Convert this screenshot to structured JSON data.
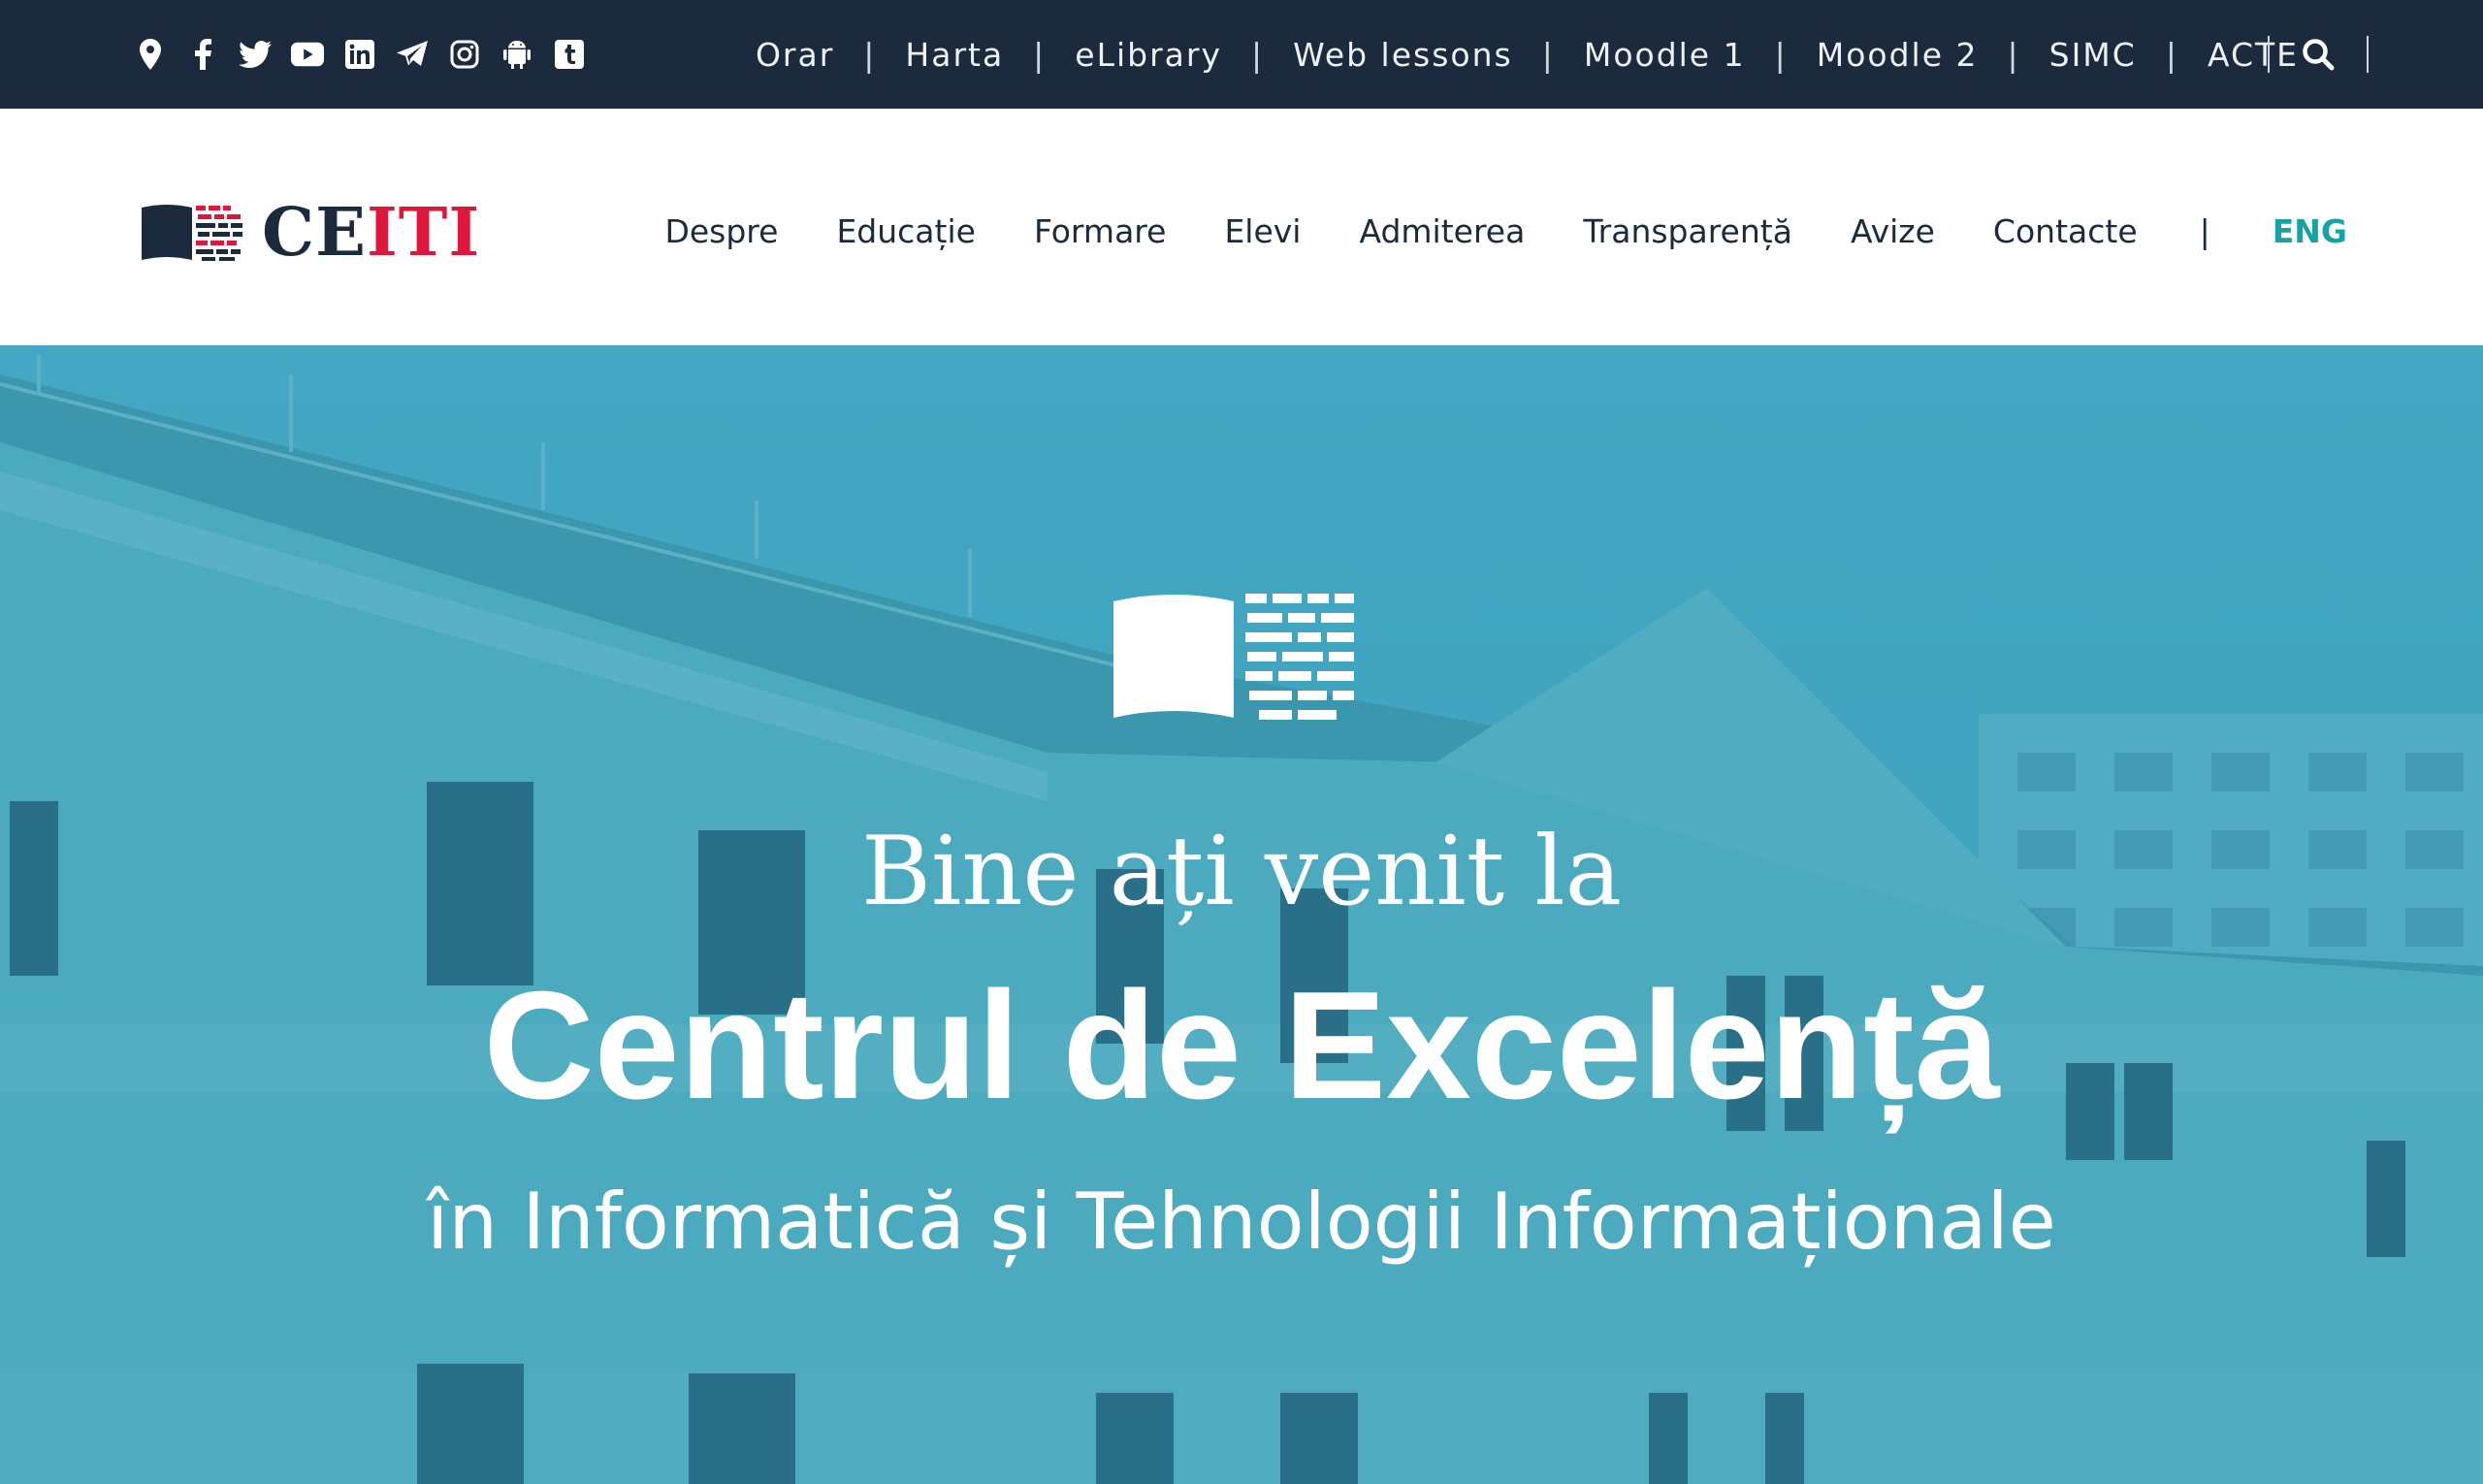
{
  "topbar": {
    "social_icons": [
      "map-pin-icon",
      "facebook-icon",
      "twitter-icon",
      "youtube-icon",
      "linkedin-icon",
      "telegram-icon",
      "instagram-icon",
      "android-icon",
      "tumblr-icon"
    ],
    "links": [
      "Orar",
      "Harta",
      "eLibrary",
      "Web lessons",
      "Moodle 1",
      "Moodle 2",
      "SIMC",
      "ACTE"
    ],
    "separator": "|",
    "search_icon": "search-icon"
  },
  "header": {
    "logo_ce": "CE",
    "logo_iti": "ITI",
    "nav": [
      "Despre",
      "Educație",
      "Formare",
      "Elevi",
      "Admiterea",
      "Transparență",
      "Avize",
      "Contacte"
    ],
    "nav_separator": "|",
    "language": "ENG"
  },
  "hero": {
    "line1": "Bine ați venit la",
    "line2": "Centrul de Excelență",
    "line3": "în Informatică și Tehnologii Informaționale"
  },
  "colors": {
    "topbar_bg": "#1c2a3d",
    "brand_red": "#e0173d",
    "brand_navy": "#1c2a3d",
    "accent_teal": "#17a3a3",
    "hero_overlay": "#3f9fb6"
  }
}
